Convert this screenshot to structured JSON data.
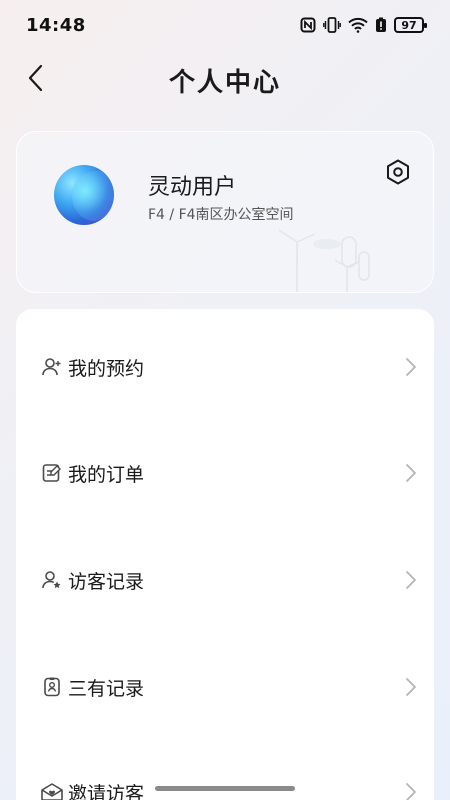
{
  "status_bar": {
    "time": "14:48",
    "battery": "97",
    "icons": [
      "nfc-icon",
      "vibrate-icon",
      "wifi-icon",
      "battery-alert-icon",
      "battery-icon"
    ]
  },
  "header": {
    "title": "个人中心",
    "back_icon": "chevron-left-icon"
  },
  "profile": {
    "name": "灵动用户",
    "location": "F4 / F4南区办公室空间",
    "settings_icon": "hexagon-settings-icon"
  },
  "menu": {
    "items": [
      {
        "label": "我的预约",
        "icon": "person-plus-icon"
      },
      {
        "label": "我的订单",
        "icon": "edit-document-icon"
      },
      {
        "label": "访客记录",
        "icon": "person-star-icon"
      },
      {
        "label": "三有记录",
        "icon": "badge-card-icon"
      },
      {
        "label": "邀请访客",
        "icon": "mail-heart-icon"
      }
    ]
  },
  "colors": {
    "text_primary": "#1a1a1a",
    "text_secondary": "#555555",
    "chevron": "#b5b5b5",
    "icon": "#4a4a4a"
  }
}
